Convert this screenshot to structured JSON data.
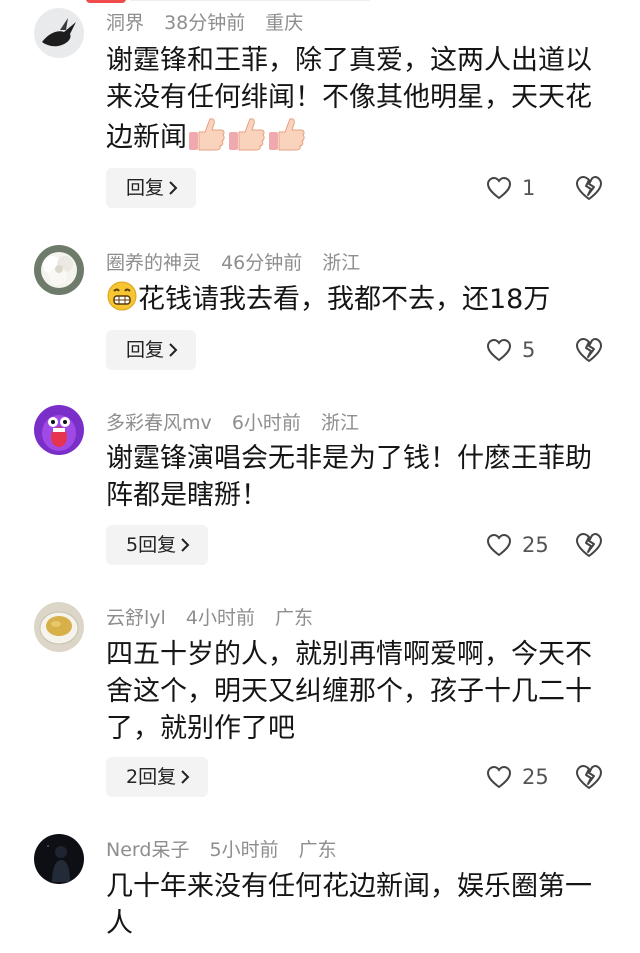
{
  "comments": [
    {
      "username": "洞界",
      "time": "38分钟前",
      "location": "重庆",
      "text": "谢霆锋和王菲，除了真爱，这两人出道以来没有任何绯闻！不像其他明星，天天花边新闻",
      "emoji": "thumbs-up-icon ×3",
      "reply_label": "回复",
      "likes": "1",
      "avatar": "bird-avatar"
    },
    {
      "username": "圈养的神灵",
      "time": "46分钟前",
      "location": "浙江",
      "text": "花钱请我去看，我都不去，还18万",
      "emoji": "grimacing-face-icon",
      "reply_label": "回复",
      "likes": "5",
      "avatar": "flower-avatar"
    },
    {
      "username": "多彩春风mv",
      "time": "6小时前",
      "location": "浙江",
      "text": "谢霆锋演唱会无非是为了钱！什麽王菲助阵都是瞎掰！",
      "reply_label": "5回复",
      "likes": "25",
      "avatar": "purple-creature-avatar"
    },
    {
      "username": "云舒lyl",
      "time": "4小时前",
      "location": "广东",
      "text": "四五十岁的人，就别再情啊爱啊，今天不舍这个，明天又纠缠那个，孩子十几二十了，就别作了吧",
      "reply_label": "2回复",
      "likes": "25",
      "avatar": "tea-cup-avatar"
    },
    {
      "username": "Nerd呆子",
      "time": "5小时前",
      "location": "广东",
      "text": "几十年来没有任何花边新闻，娱乐圈第一人",
      "avatar": "dark-figure-avatar"
    }
  ]
}
